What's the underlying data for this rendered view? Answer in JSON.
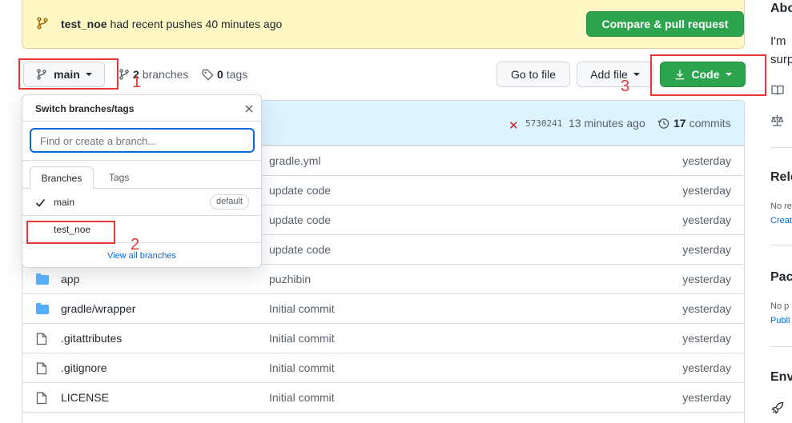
{
  "banner": {
    "branch": "test_noe",
    "message": "had recent pushes 40 minutes ago",
    "compare_label": "Compare & pull request"
  },
  "toolbar": {
    "branch_label": "main",
    "branches_count": "2",
    "branches_label": "branches",
    "tags_count": "0",
    "tags_label": "tags",
    "goto_file_label": "Go to file",
    "add_file_label": "Add file",
    "code_label": "Code"
  },
  "annotations": [
    "1",
    "2",
    "3"
  ],
  "commit": {
    "status": "✕",
    "sha": "5730241",
    "time": "13 minutes ago",
    "count": "17",
    "count_label": "commits"
  },
  "files": [
    {
      "type": "hidden",
      "name": "",
      "message": "gradle.yml",
      "date": "yesterday"
    },
    {
      "type": "hidden",
      "name": "",
      "message": "update code",
      "date": "yesterday"
    },
    {
      "type": "hidden",
      "name": "",
      "message": "update code",
      "date": "yesterday"
    },
    {
      "type": "hidden",
      "name": "",
      "message": "update code",
      "date": "yesterday"
    },
    {
      "type": "folder",
      "name": "app",
      "message": "puzhibin",
      "date": "yesterday"
    },
    {
      "type": "folder",
      "name": "gradle/wrapper",
      "message": "Initial commit",
      "date": "yesterday"
    },
    {
      "type": "file",
      "name": ".gitattributes",
      "message": "Initial commit",
      "date": "yesterday"
    },
    {
      "type": "file",
      "name": ".gitignore",
      "message": "Initial commit",
      "date": "yesterday"
    },
    {
      "type": "file",
      "name": "LICENSE",
      "message": "Initial commit",
      "date": "yesterday"
    }
  ],
  "dropdown": {
    "title": "Switch branches/tags",
    "placeholder": "Find or create a branch...",
    "tab_branches": "Branches",
    "tab_tags": "Tags",
    "branches": [
      {
        "name": "main",
        "selected": true,
        "badge": "default"
      },
      {
        "name": "test_noe",
        "selected": false,
        "badge": ""
      }
    ],
    "view_all": "View all branches"
  },
  "sidebar": {
    "about_head": "Abo",
    "about_line1": "I'm",
    "about_line2": "surp",
    "releases_head": "Rele",
    "releases_text": "No re",
    "releases_link": "Creat",
    "packages_head": "Pac",
    "packages_text": "No p",
    "packages_link": "Publi",
    "env_head": "Env"
  },
  "colors": {
    "green": "#2da44e",
    "banner_bg": "#fff8c5",
    "commit_bg": "#ddf4ff",
    "link": "#0969da",
    "annotation_red": "#e53935"
  }
}
